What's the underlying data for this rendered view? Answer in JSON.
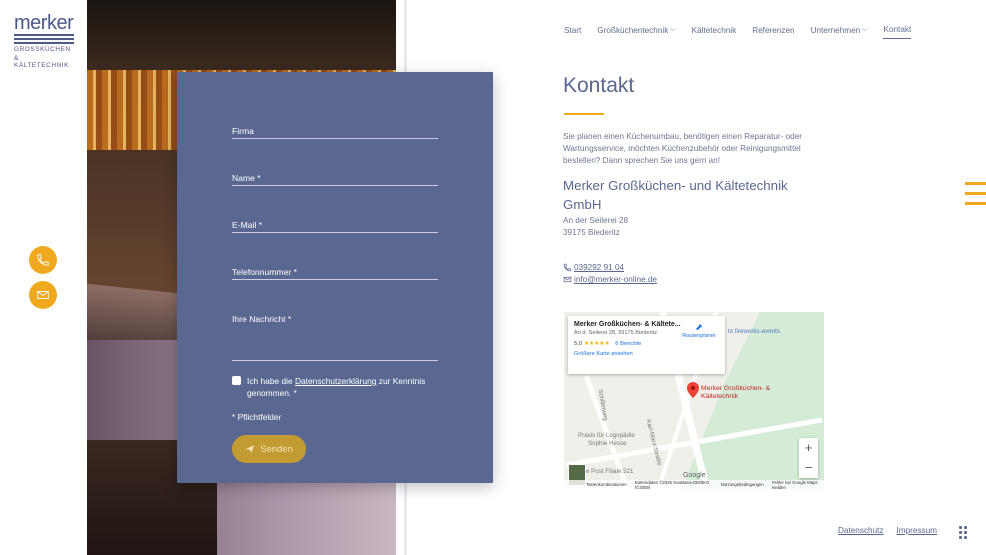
{
  "logo": {
    "word": "merker",
    "sub_line1": "GROSSKÜCHEN",
    "sub_line2": "& KÄLTETECHNIK"
  },
  "nav": {
    "items": [
      {
        "label": "Start",
        "dropdown": false
      },
      {
        "label": "Großküchentechnik",
        "dropdown": true
      },
      {
        "label": "Kältetechnik",
        "dropdown": false
      },
      {
        "label": "Referenzen",
        "dropdown": false
      },
      {
        "label": "Unternehmen",
        "dropdown": true
      },
      {
        "label": "Kontakt",
        "dropdown": false,
        "active": true
      }
    ]
  },
  "form": {
    "fields": [
      {
        "label": "Firma"
      },
      {
        "label": "Name *"
      },
      {
        "label": "E-Mail *"
      },
      {
        "label": "Telefonnummer *"
      },
      {
        "label": "Ihre Nachricht *"
      }
    ],
    "consent_before": "Ich habe die ",
    "consent_link": "Datenschutzerklärung",
    "consent_after": " zur Kenntnis genommen. *",
    "required_note": "* Pflichtfelder",
    "submit_label": "Senden"
  },
  "content": {
    "title": "Kontakt",
    "intro": "Sie planen einen Küchenumbau, benötigen einen Reparatur- oder Wartungsservice, möchten Küchenzubehör oder Reinigungsmittel bestellen? Dann sprechen Sie uns gern an!",
    "company": "Merker Großküchen- und Kältetechnik GmbH",
    "street": "An der Seilerei 28",
    "city": "39175 Biederitz",
    "phone": "039292 91 04",
    "email": "info@merker-online.de"
  },
  "map": {
    "card_title": "Merker Großküchen- & Kältete...",
    "card_address": "An d. Seilerei 28, 39175 Biederitz",
    "rating": "5,0",
    "stars": "★★★★★",
    "reviews": "6 Berichte",
    "bigger_map": "Größere Karte ansehen",
    "route": "Routenplaner",
    "marker_label_1": "Merker Großküchen- &",
    "marker_label_2": "Kältetechnik",
    "poi_fireworks": "to fireworks-events",
    "poi_praxis_1": "Praxis für Logopädie",
    "poi_praxis_2": "Sophie Hesse",
    "poi_post": "e Post Filiale 521",
    "street_karl": "Karl-Marx-Straße",
    "street_schiller": "Schillerweg",
    "zoom_in": "+",
    "zoom_out": "−",
    "google": "Google",
    "footer_keys": "Tastenkombinationen",
    "footer_data": "Kartendaten ©2025 GeoBasis-DE/BKG (©2009)",
    "footer_terms": "Nutzungsbedingungen",
    "footer_report": "Fehler bei Google Maps melden"
  },
  "footer": {
    "privacy": "Datenschutz",
    "imprint": "Impressum"
  },
  "colors": {
    "accent": "#f0a81e",
    "primary": "#5a6891",
    "button_gold": "#c39b33"
  },
  "icons": {
    "phone": "phone-icon",
    "mail": "mail-icon",
    "send": "paper-plane-icon",
    "menu": "hamburger-menu-icon"
  }
}
